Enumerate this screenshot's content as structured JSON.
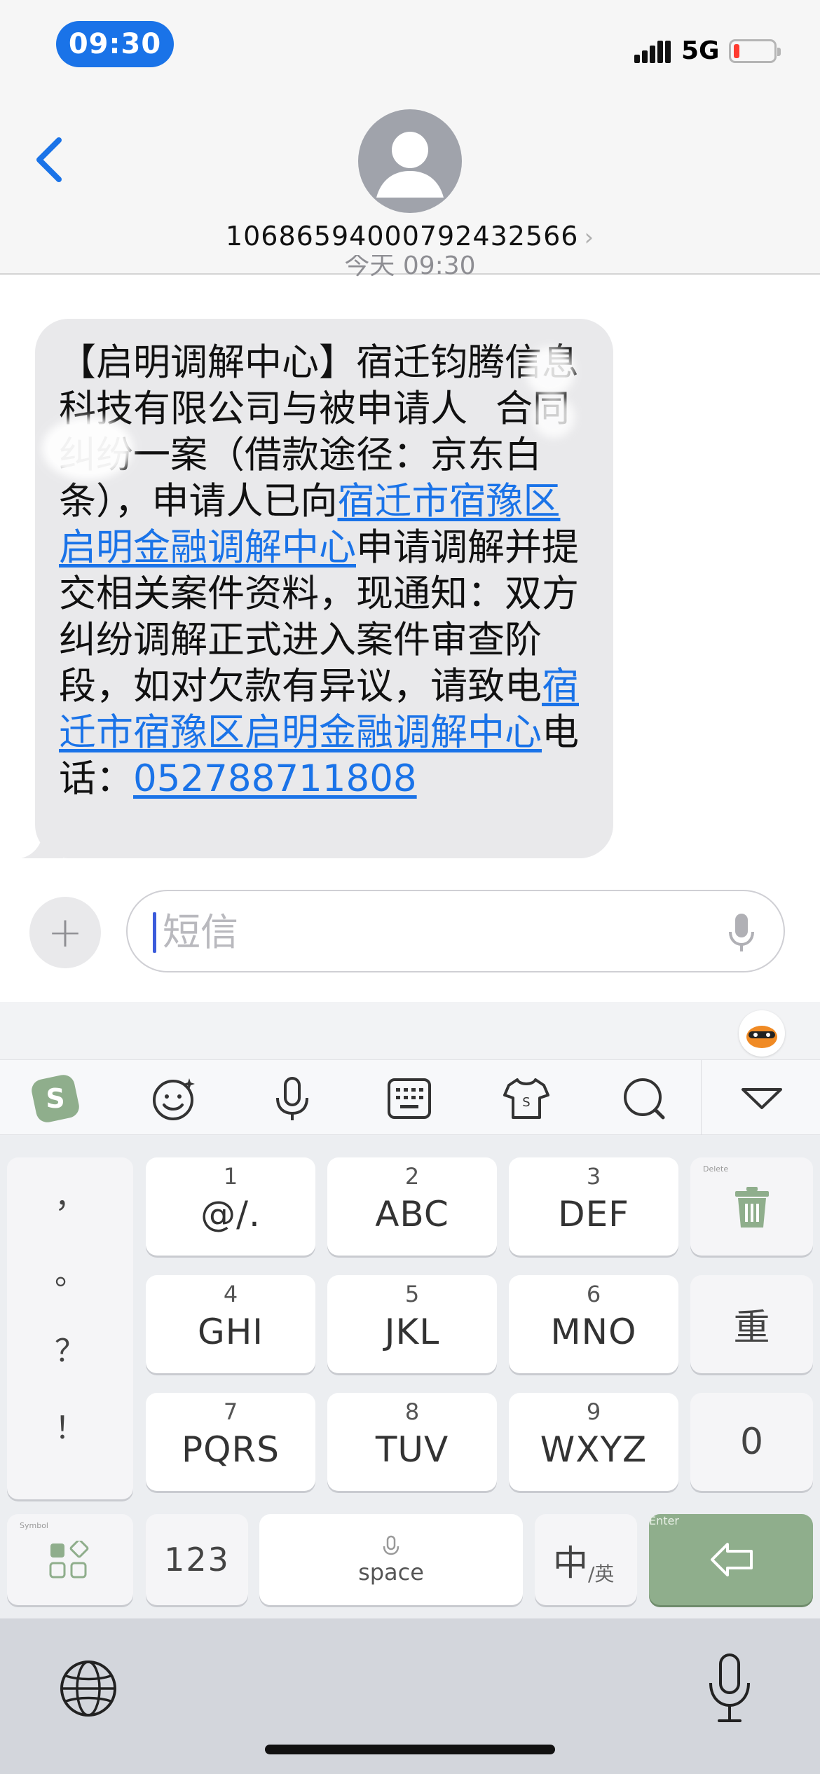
{
  "status_bar": {
    "time": "09:30",
    "network": "5G",
    "battery_level": 0.1
  },
  "header": {
    "contact": "10686594000792432566",
    "back_icon": "chevron-left-icon",
    "avatar_icon": "person-icon"
  },
  "thread": {
    "timestamp": "今天 09:30",
    "message": {
      "part1": "【启明调解中心】宿迁钧腾信息科技有限公司与被申请人",
      "part2": "合同纠纷一案（借款途径：京东白条），申请人已向",
      "link1": "宿迁市宿豫区启明金融调解中心",
      "part3": "申请调解并提交相关案件资料，现通知：双方纠纷调解正式进入案件审查阶段，如对欠款有异议，请致电",
      "link2": "宿迁市宿豫区启明金融调解中心",
      "part4": "电话：",
      "phone": "052788711808"
    }
  },
  "composer": {
    "placeholder": "短信",
    "plus_icon": "plus-icon",
    "mic_icon": "microphone-icon"
  },
  "keyboard": {
    "toolbar": [
      "sogou-logo-icon",
      "emoji-icon",
      "voice-icon",
      "keyboard-icon",
      "skin-icon",
      "search-icon",
      "collapse-icon"
    ],
    "punctuation": [
      "，",
      "。",
      "？",
      "！"
    ],
    "keys": [
      {
        "num": "1",
        "letters": "@/."
      },
      {
        "num": "2",
        "letters": "ABC"
      },
      {
        "num": "3",
        "letters": "DEF"
      },
      {
        "num": "4",
        "letters": "GHI"
      },
      {
        "num": "5",
        "letters": "JKL"
      },
      {
        "num": "6",
        "letters": "MNO"
      },
      {
        "num": "7",
        "letters": "PQRS"
      },
      {
        "num": "8",
        "letters": "TUV"
      },
      {
        "num": "9",
        "letters": "WXYZ"
      }
    ],
    "delete_hint": "Delete",
    "redo_label": "重",
    "zero_label": "0",
    "symbol_hint": "Symbol",
    "numeric_label": "123",
    "space_label": "space",
    "lang_main": "中",
    "lang_sub": "/英",
    "enter_hint": "Enter",
    "accent_color": "#8fae8c"
  },
  "system": {
    "globe_icon": "globe-icon",
    "dictation_icon": "microphone-icon"
  }
}
